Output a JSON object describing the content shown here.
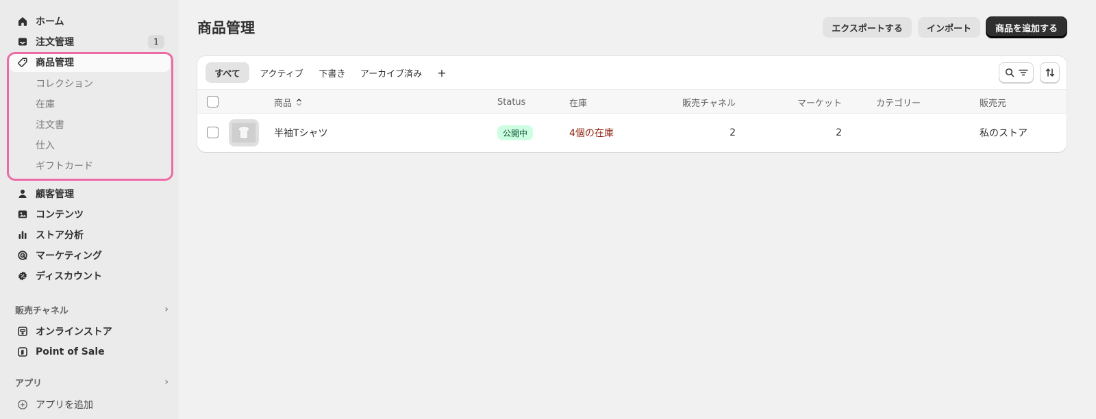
{
  "sidebar": {
    "nav": [
      {
        "label": "ホーム",
        "icon": "home-icon"
      },
      {
        "label": "注文管理",
        "icon": "inbox-icon",
        "count": "1"
      },
      {
        "label": "商品管理",
        "icon": "tag-icon"
      }
    ],
    "products_sub": [
      "コレクション",
      "在庫",
      "注文書",
      "仕入",
      "ギフトカード"
    ],
    "nav2": [
      {
        "label": "顧客管理",
        "icon": "person-icon"
      },
      {
        "label": "コンテンツ",
        "icon": "image-icon"
      },
      {
        "label": "ストア分析",
        "icon": "bar-chart-icon"
      },
      {
        "label": "マーケティング",
        "icon": "target-icon"
      },
      {
        "label": "ディスカウント",
        "icon": "discount-icon"
      }
    ],
    "sales_channels": {
      "heading": "販売チャネル",
      "items": [
        {
          "label": "オンラインストア",
          "icon": "store-icon"
        },
        {
          "label": "Point of Sale",
          "icon": "pos-icon"
        }
      ]
    },
    "apps": {
      "heading": "アプリ",
      "add_label": "アプリを追加"
    }
  },
  "header": {
    "title": "商品管理",
    "export_label": "エクスポートする",
    "import_label": "インポート",
    "add_label": "商品を追加する"
  },
  "tabs": [
    "すべて",
    "アクティブ",
    "下書き",
    "アーカイブ済み",
    "+"
  ],
  "table": {
    "columns": {
      "product": "商品",
      "status": "Status",
      "inventory": "在庫",
      "channels": "販売チャネル",
      "markets": "マーケット",
      "category": "カテゴリー",
      "vendor": "販売元"
    },
    "rows": [
      {
        "product": "半袖Tシャツ",
        "status": "公開中",
        "inventory": "4個の在庫",
        "channels": "2",
        "markets": "2",
        "category": "",
        "vendor": "私のストア"
      }
    ]
  },
  "colors": {
    "accent_highlight": "#ee6aa4",
    "status_active_bg": "#cdfee1",
    "status_active_text": "#0c5132",
    "inventory_warning": "#8e1f0b",
    "primary_button": "#303030"
  }
}
